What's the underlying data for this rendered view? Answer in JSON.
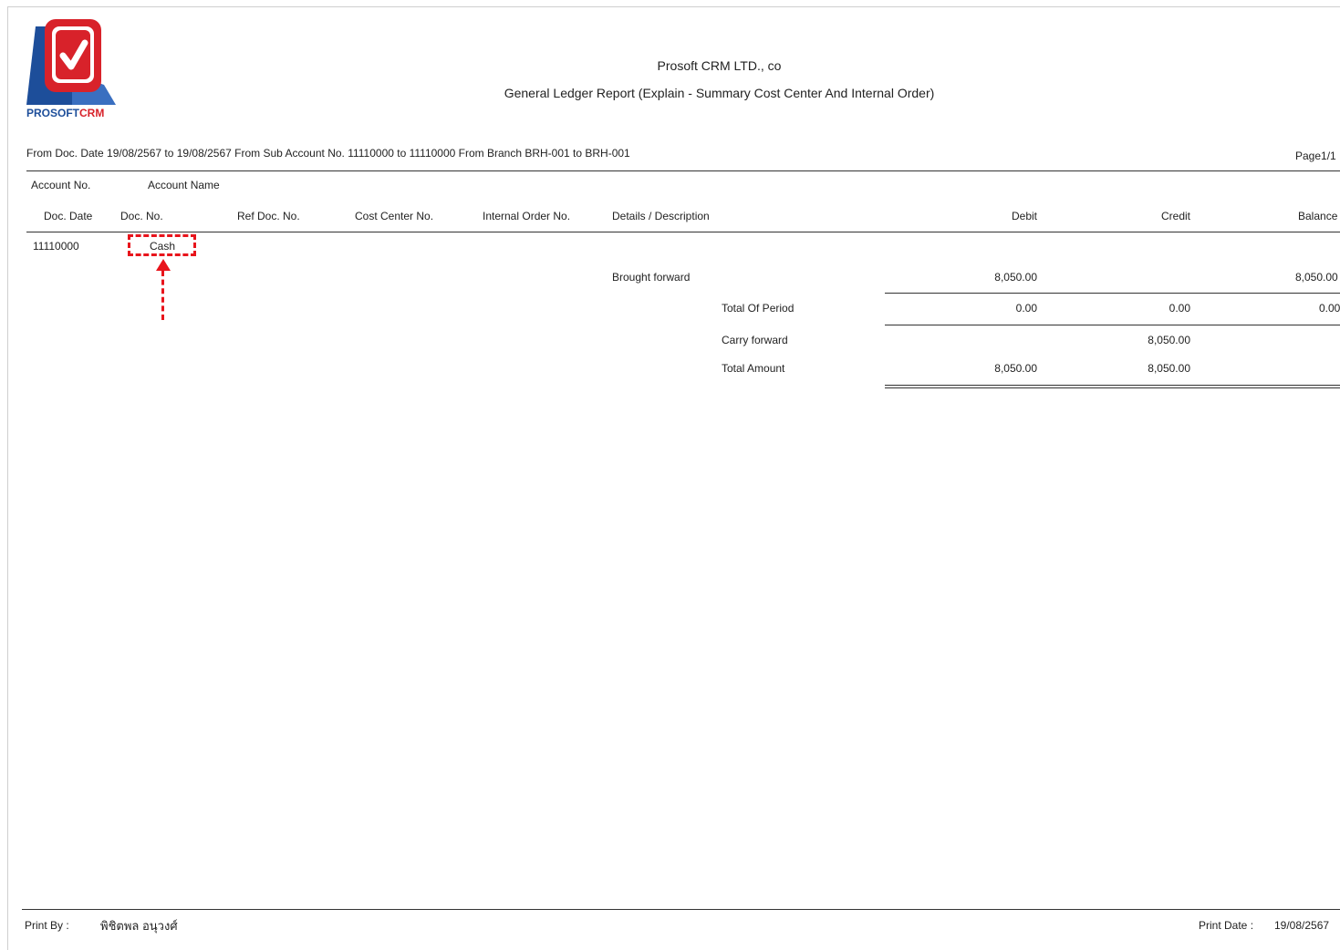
{
  "logo": {
    "word1": "PROSOFT",
    "word2": "CRM",
    "brand_blue": "#1d4e9a",
    "brand_red": "#d8222a"
  },
  "report": {
    "company": "Prosoft CRM LTD., co",
    "title": "General Ledger Report (Explain - Summary Cost Center And Internal Order)",
    "criteria": "From Doc. Date 19/08/2567 to 19/08/2567 From Sub Account No. 11110000 to 11110000 From Branch BRH-001 to BRH-001",
    "page": "Page1/1"
  },
  "columns": {
    "account_no": "Account No.",
    "account_name": "Account Name",
    "doc_date": "Doc. Date",
    "doc_no": "Doc. No.",
    "ref_doc_no": "Ref Doc. No.",
    "cost_center_no": "Cost Center No.",
    "internal_order_no": "Internal Order No.",
    "details": "Details / Description",
    "debit": "Debit",
    "credit": "Credit",
    "balance": "Balance"
  },
  "account": {
    "number": "11110000",
    "name": "Cash"
  },
  "rows": {
    "brought_forward": {
      "label": "Brought forward",
      "debit": "8,050.00",
      "balance": "8,050.00"
    },
    "total_of_period": {
      "label": "Total Of Period",
      "debit": "0.00",
      "credit": "0.00",
      "balance": "0.00"
    },
    "carry_forward": {
      "label": "Carry forward",
      "credit": "8,050.00"
    },
    "total_amount": {
      "label": "Total Amount",
      "debit": "8,050.00",
      "credit": "8,050.00"
    }
  },
  "footer": {
    "print_by_label": "Print By :",
    "print_by_name": "พิชิตพล อนุวงศ์",
    "print_date_label": "Print Date :",
    "print_date": "19/08/2567"
  },
  "annotation_color": "#e8141c"
}
